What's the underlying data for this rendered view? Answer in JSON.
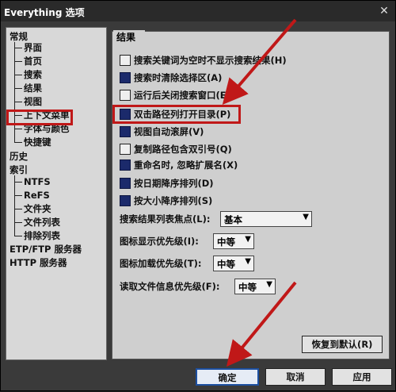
{
  "window": {
    "title": "Everything 选项",
    "close_icon": "close-icon"
  },
  "tree": {
    "items": [
      {
        "label": "常规"
      },
      {
        "label": "界面"
      },
      {
        "label": "首页"
      },
      {
        "label": "搜索"
      },
      {
        "label": "结果"
      },
      {
        "label": "视图"
      },
      {
        "label": "上下文菜单"
      },
      {
        "label": "字体与颜色"
      },
      {
        "label": "快捷键"
      },
      {
        "label": "历史"
      },
      {
        "label": "索引"
      },
      {
        "label": "NTFS"
      },
      {
        "label": "ReFS"
      },
      {
        "label": "文件夹"
      },
      {
        "label": "文件列表"
      },
      {
        "label": "排除列表"
      },
      {
        "label": "ETP/FTP 服务器"
      },
      {
        "label": "HTTP 服务器"
      }
    ]
  },
  "group": {
    "title": "结果"
  },
  "options": [
    {
      "label": "搜索关键词为空时不显示搜索结果(H)",
      "checked": false
    },
    {
      "label": "搜索时清除选择区(A)",
      "checked": true
    },
    {
      "label": "运行后关闭搜索窗口(E)",
      "checked": false
    },
    {
      "label": "双击路径列打开目录(P)",
      "checked": true
    },
    {
      "label": "视图自动滚屏(V)",
      "checked": true
    },
    {
      "label": "复制路径包含双引号(Q)",
      "checked": false
    },
    {
      "label": "重命名时, 忽略扩展名(X)",
      "checked": true
    },
    {
      "label": "按日期降序排列(D)",
      "checked": true
    },
    {
      "label": "按大小降序排列(S)",
      "checked": true
    }
  ],
  "fields": [
    {
      "label": "搜索结果列表焦点(L):",
      "value": "基本"
    },
    {
      "label": "图标显示优先级(I):",
      "value": "中等"
    },
    {
      "label": "图标加载优先级(T):",
      "value": "中等"
    },
    {
      "label": "读取文件信息优先级(F):",
      "value": "中等"
    }
  ],
  "buttons": {
    "restore_defaults": "恢复到默认(R)",
    "ok": "确定",
    "cancel": "取消",
    "apply": "应用"
  },
  "colors": {
    "annotation_red": "#c01818",
    "checked_fill": "#1b2a6b"
  }
}
